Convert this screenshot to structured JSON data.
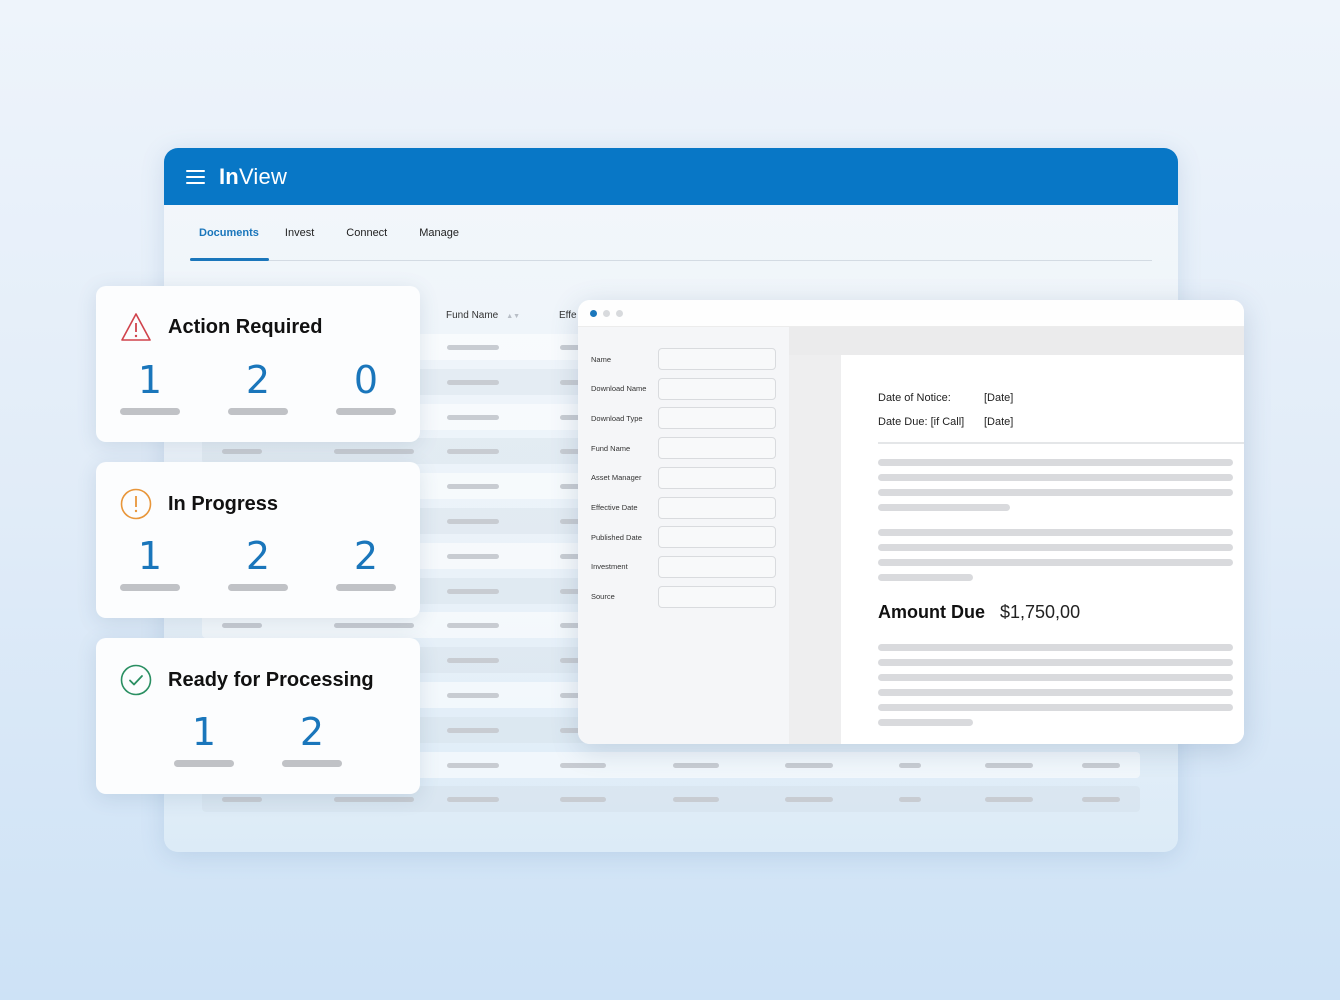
{
  "app": {
    "brand_bold": "In",
    "brand_light": "View",
    "menu_icon": "hamburger-menu-icon"
  },
  "nav": {
    "tabs": [
      {
        "label": "Documents",
        "active": true
      },
      {
        "label": "Invest",
        "active": false
      },
      {
        "label": "Connect",
        "active": false
      },
      {
        "label": "Manage",
        "active": false
      }
    ]
  },
  "table": {
    "columns": [
      "Fund Name",
      "Effe"
    ],
    "sort_icon": "sort-icon"
  },
  "status_cards": [
    {
      "title": "Action Required",
      "icon": "warning-triangle-icon",
      "color": "#d0434c",
      "counts": [
        "1",
        "2",
        "0"
      ]
    },
    {
      "title": "In Progress",
      "icon": "exclamation-circle-icon",
      "color": "#e8963a",
      "counts": [
        "1",
        "2",
        "2"
      ]
    },
    {
      "title": "Ready for Processing",
      "icon": "check-circle-icon",
      "color": "#2a8f62",
      "counts": [
        "1",
        "2"
      ]
    }
  ],
  "document_window": {
    "form_fields": [
      {
        "label": "Name",
        "value": ""
      },
      {
        "label": "Download Name",
        "value": ""
      },
      {
        "label": "Download Type",
        "value": ""
      },
      {
        "label": "Fund Name",
        "value": ""
      },
      {
        "label": "Asset Manager",
        "value": ""
      },
      {
        "label": "Effective Date",
        "value": ""
      },
      {
        "label": "Published Date",
        "value": ""
      },
      {
        "label": "Investment",
        "value": ""
      },
      {
        "label": "Source",
        "value": ""
      }
    ],
    "preview": {
      "date_of_notice_label": "Date of Notice:",
      "date_of_notice_value": "[Date]",
      "date_due_label": "Date Due: [if Call]",
      "date_due_value": "[Date]",
      "amount_due_label": "Amount Due",
      "amount_due_value": "$1,750,00"
    }
  },
  "colors": {
    "brand_blue": "#0877c6",
    "accent_blue": "#1a76bb"
  }
}
